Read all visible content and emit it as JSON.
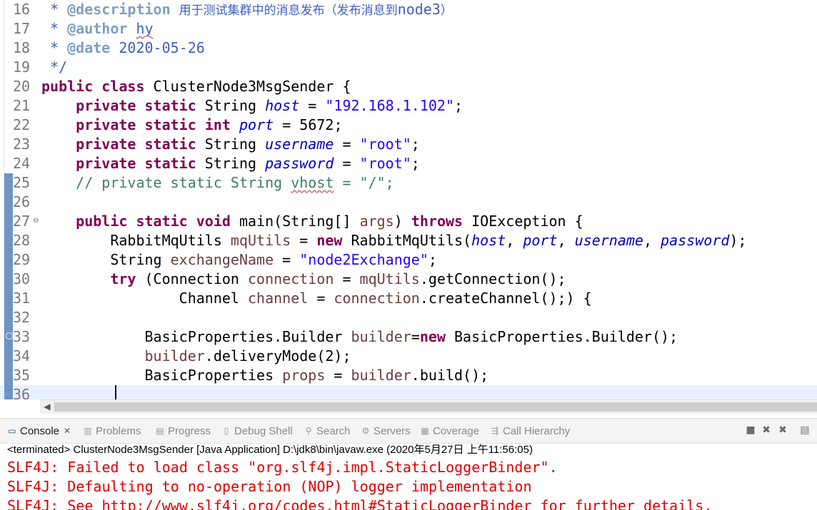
{
  "editor": {
    "lines": [
      {
        "n": "16",
        "tokens": [
          {
            "t": " * ",
            "c": "doc"
          },
          {
            "t": "@description",
            "c": "dtag"
          },
          {
            "t": " ",
            "c": "doc"
          },
          {
            "t": "用于测试集群中的消息发布（发布消息到",
            "c": "doc cjk"
          },
          {
            "t": "node3",
            "c": "doc"
          },
          {
            "t": "）",
            "c": "doc cjk"
          }
        ]
      },
      {
        "n": "17",
        "tokens": [
          {
            "t": " * ",
            "c": "doc"
          },
          {
            "t": "@author",
            "c": "dtag"
          },
          {
            "t": " ",
            "c": "doc"
          },
          {
            "t": "hy",
            "c": "doc squig"
          }
        ]
      },
      {
        "n": "18",
        "tokens": [
          {
            "t": " * ",
            "c": "doc"
          },
          {
            "t": "@date",
            "c": "dtag"
          },
          {
            "t": " 2020-05-26",
            "c": "doc"
          }
        ]
      },
      {
        "n": "19",
        "tokens": [
          {
            "t": " */",
            "c": "doc"
          }
        ]
      },
      {
        "n": "20",
        "tokens": [
          {
            "t": "public",
            "c": "kw"
          },
          {
            "t": " "
          },
          {
            "t": "class",
            "c": "kw"
          },
          {
            "t": " ClusterNode3MsgSender {"
          }
        ]
      },
      {
        "n": "21",
        "tokens": [
          {
            "t": "    "
          },
          {
            "t": "private",
            "c": "kw"
          },
          {
            "t": " "
          },
          {
            "t": "static",
            "c": "kw"
          },
          {
            "t": " String "
          },
          {
            "t": "host",
            "c": "fld"
          },
          {
            "t": " = "
          },
          {
            "t": "\"192.168.1.102\"",
            "c": "str"
          },
          {
            "t": ";"
          }
        ]
      },
      {
        "n": "22",
        "tokens": [
          {
            "t": "    "
          },
          {
            "t": "private",
            "c": "kw"
          },
          {
            "t": " "
          },
          {
            "t": "static",
            "c": "kw"
          },
          {
            "t": " "
          },
          {
            "t": "int",
            "c": "kw"
          },
          {
            "t": " "
          },
          {
            "t": "port",
            "c": "fld"
          },
          {
            "t": " = 5672;"
          }
        ]
      },
      {
        "n": "23",
        "tokens": [
          {
            "t": "    "
          },
          {
            "t": "private",
            "c": "kw"
          },
          {
            "t": " "
          },
          {
            "t": "static",
            "c": "kw"
          },
          {
            "t": " String "
          },
          {
            "t": "username",
            "c": "fld"
          },
          {
            "t": " = "
          },
          {
            "t": "\"root\"",
            "c": "str"
          },
          {
            "t": ";"
          }
        ]
      },
      {
        "n": "24",
        "tokens": [
          {
            "t": "    "
          },
          {
            "t": "private",
            "c": "kw"
          },
          {
            "t": " "
          },
          {
            "t": "static",
            "c": "kw"
          },
          {
            "t": " String "
          },
          {
            "t": "password",
            "c": "fld"
          },
          {
            "t": " = "
          },
          {
            "t": "\"root\"",
            "c": "str"
          },
          {
            "t": ";"
          }
        ]
      },
      {
        "n": "25",
        "tokens": [
          {
            "t": "    // private static String ",
            "c": "cmt"
          },
          {
            "t": "vhost",
            "c": "cmt squig"
          },
          {
            "t": " = \"/\";",
            "c": "cmt"
          }
        ]
      },
      {
        "n": "26",
        "tokens": []
      },
      {
        "n": "27",
        "tokens": [
          {
            "t": "    "
          },
          {
            "t": "public",
            "c": "kw"
          },
          {
            "t": " "
          },
          {
            "t": "static",
            "c": "kw"
          },
          {
            "t": " "
          },
          {
            "t": "void",
            "c": "kw"
          },
          {
            "t": " main(String[] "
          },
          {
            "t": "args",
            "c": "var"
          },
          {
            "t": ") "
          },
          {
            "t": "throws",
            "c": "kw"
          },
          {
            "t": " IOException {"
          }
        ]
      },
      {
        "n": "28",
        "tokens": [
          {
            "t": "        RabbitMqUtils "
          },
          {
            "t": "mqUtils",
            "c": "var"
          },
          {
            "t": " = "
          },
          {
            "t": "new",
            "c": "kw"
          },
          {
            "t": " RabbitMqUtils("
          },
          {
            "t": "host",
            "c": "fld"
          },
          {
            "t": ", "
          },
          {
            "t": "port",
            "c": "fld"
          },
          {
            "t": ", "
          },
          {
            "t": "username",
            "c": "fld"
          },
          {
            "t": ", "
          },
          {
            "t": "password",
            "c": "fld"
          },
          {
            "t": ");"
          }
        ]
      },
      {
        "n": "29",
        "tokens": [
          {
            "t": "        String "
          },
          {
            "t": "exchangeName",
            "c": "var"
          },
          {
            "t": " = "
          },
          {
            "t": "\"node2Exchange\"",
            "c": "str"
          },
          {
            "t": ";"
          }
        ]
      },
      {
        "n": "30",
        "tokens": [
          {
            "t": "        "
          },
          {
            "t": "try",
            "c": "kw"
          },
          {
            "t": " (Connection "
          },
          {
            "t": "connection",
            "c": "var"
          },
          {
            "t": " = "
          },
          {
            "t": "mqUtils",
            "c": "var"
          },
          {
            "t": ".getConnection();"
          }
        ]
      },
      {
        "n": "31",
        "tokens": [
          {
            "t": "                Channel "
          },
          {
            "t": "channel",
            "c": "var"
          },
          {
            "t": " = "
          },
          {
            "t": "connection",
            "c": "var"
          },
          {
            "t": ".createChannel();) {"
          }
        ]
      },
      {
        "n": "32",
        "tokens": []
      },
      {
        "n": "33",
        "tokens": [
          {
            "t": "            BasicProperties.Builder "
          },
          {
            "t": "builder",
            "c": "var"
          },
          {
            "t": "="
          },
          {
            "t": "new",
            "c": "kw"
          },
          {
            "t": " BasicProperties.Builder();"
          }
        ]
      },
      {
        "n": "34",
        "tokens": [
          {
            "t": "            "
          },
          {
            "t": "builder",
            "c": "var"
          },
          {
            "t": ".deliveryMode(2);"
          }
        ]
      },
      {
        "n": "35",
        "tokens": [
          {
            "t": "            BasicProperties "
          },
          {
            "t": "props",
            "c": "var"
          },
          {
            "t": " = "
          },
          {
            "t": "builder",
            "c": "var"
          },
          {
            "t": ".build();"
          }
        ]
      },
      {
        "n": "36",
        "tokens": []
      }
    ],
    "current_line": "36"
  },
  "console": {
    "tabs": [
      {
        "label": "Console",
        "icon": "console-icon",
        "active": true
      },
      {
        "label": "Problems",
        "icon": "problems-icon"
      },
      {
        "label": "Progress",
        "icon": "progress-icon"
      },
      {
        "label": "Debug Shell",
        "icon": "debug-shell-icon"
      },
      {
        "label": "Search",
        "icon": "search-icon"
      },
      {
        "label": "Servers",
        "icon": "servers-icon"
      },
      {
        "label": "Coverage",
        "icon": "coverage-icon"
      },
      {
        "label": "Call Hierarchy",
        "icon": "call-hierarchy-icon"
      }
    ],
    "status": "<terminated> ClusterNode3MsgSender [Java Application] D:\\jdk8\\bin\\javaw.exe (2020年5月27日 上午11:56:05)",
    "output": [
      "SLF4J: Failed to load class \"org.slf4j.impl.StaticLoggerBinder\".",
      "SLF4J: Defaulting to no-operation (NOP) logger implementation",
      "SLF4J: See http://www.slf4j.org/codes.html#StaticLoggerBinder for further details."
    ],
    "error_color": "#e00000"
  }
}
